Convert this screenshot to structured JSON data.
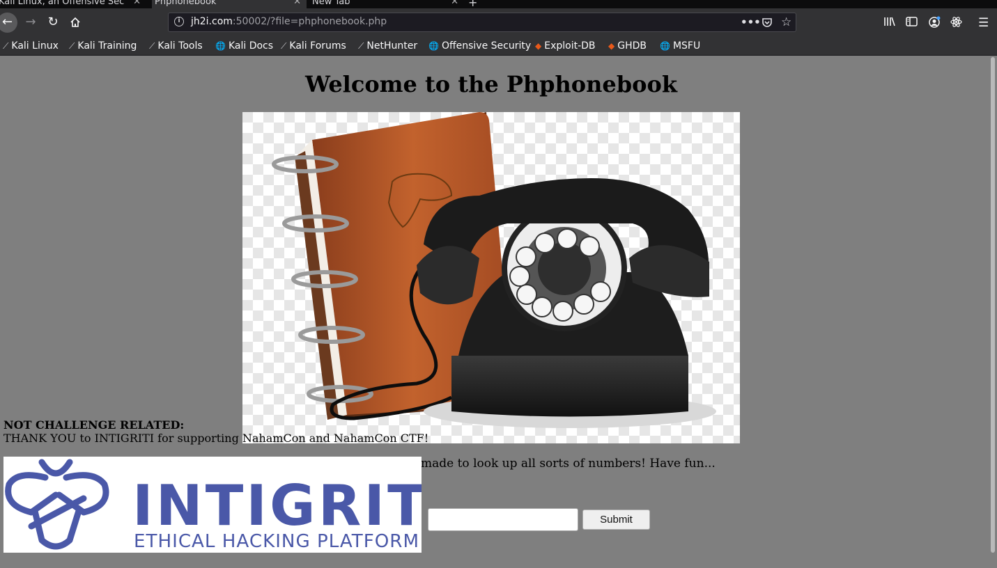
{
  "browser": {
    "tabs": [
      {
        "label": "Kali Linux, an Offensive Sec",
        "active": false
      },
      {
        "label": "Phphonebook",
        "active": true
      },
      {
        "label": "New Tab",
        "active": false
      }
    ],
    "url": {
      "host": "jh2i.com",
      "rest": ":50002/?file=phphonebook.php"
    },
    "bookmarks": [
      {
        "label": "Kali Linux",
        "icon": "kali-dragon-icon"
      },
      {
        "label": "Kali Training",
        "icon": "kali-dragon-icon"
      },
      {
        "label": "Kali Tools",
        "icon": "kali-dragon-icon"
      },
      {
        "label": "Kali Docs",
        "icon": "globe-icon"
      },
      {
        "label": "Kali Forums",
        "icon": "kali-dragon-icon"
      },
      {
        "label": "NetHunter",
        "icon": "kali-dragon-icon"
      },
      {
        "label": "Offensive Security",
        "icon": "globe-icon"
      },
      {
        "label": "Exploit-DB",
        "icon": "exploit-db-icon"
      },
      {
        "label": "GHDB",
        "icon": "exploit-db-icon"
      },
      {
        "label": "MSFU",
        "icon": "globe-icon"
      }
    ]
  },
  "page": {
    "title": "Welcome to the Phphonebook",
    "description_tail": "made to look up all sorts of numbers! Have fun...",
    "form": {
      "label_tail": ":",
      "input_value": "",
      "submit_label": "Submit"
    },
    "sponsor": {
      "heading": "NOT CHALLENGE RELATED:",
      "text": "THANK YOU to INTIGRITI for supporting NahamCon and NahamCon CTF!",
      "logo_wordmark": "INTIGRITI",
      "logo_tagline": "ETHICAL HACKING PLATFORM"
    }
  },
  "colors": {
    "page_bg": "#7f7f7f",
    "toolbar_bg": "#323234",
    "intigriti_blue": "#4a58a8",
    "book_brown": "#b3572a"
  }
}
